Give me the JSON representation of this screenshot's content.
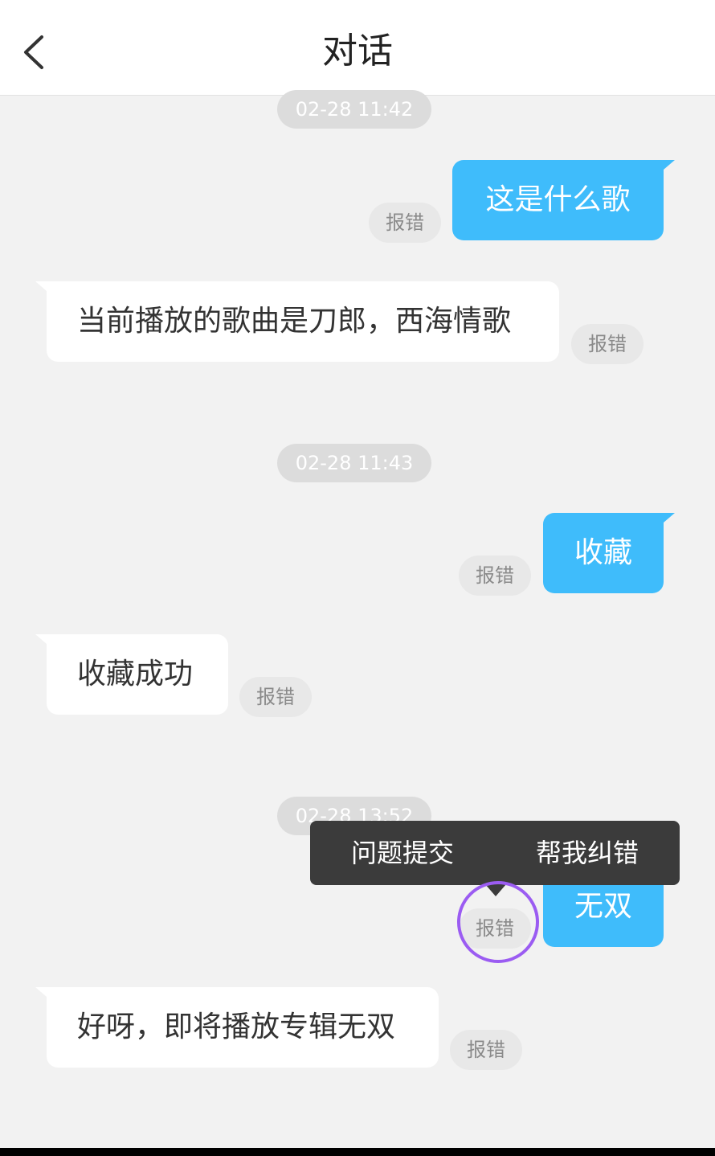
{
  "header": {
    "title": "对话",
    "back_icon": "back-arrow-icon"
  },
  "timestamps": [
    "02-28 11:42",
    "02-28 11:43",
    "02-28 13:52"
  ],
  "messages": [
    {
      "side": "out",
      "text": "这是什么歌",
      "report": "报错"
    },
    {
      "side": "in",
      "text": "当前播放的歌曲是刀郎，西海情歌",
      "report": "报错"
    },
    {
      "side": "out",
      "text": "收藏",
      "report": "报错"
    },
    {
      "side": "in",
      "text": "收藏成功",
      "report": "报错"
    },
    {
      "side": "out",
      "text": "无双",
      "report": "报错"
    },
    {
      "side": "in",
      "text": "好呀，即将播放专辑无双",
      "report": "报错"
    }
  ],
  "popup": {
    "items": [
      "问题提交",
      "帮我纠错"
    ]
  },
  "colors": {
    "accent": "#3fbcfb",
    "background": "#f2f2f2",
    "popup": "#3b3b3b",
    "highlight": "#9b5cf2"
  }
}
